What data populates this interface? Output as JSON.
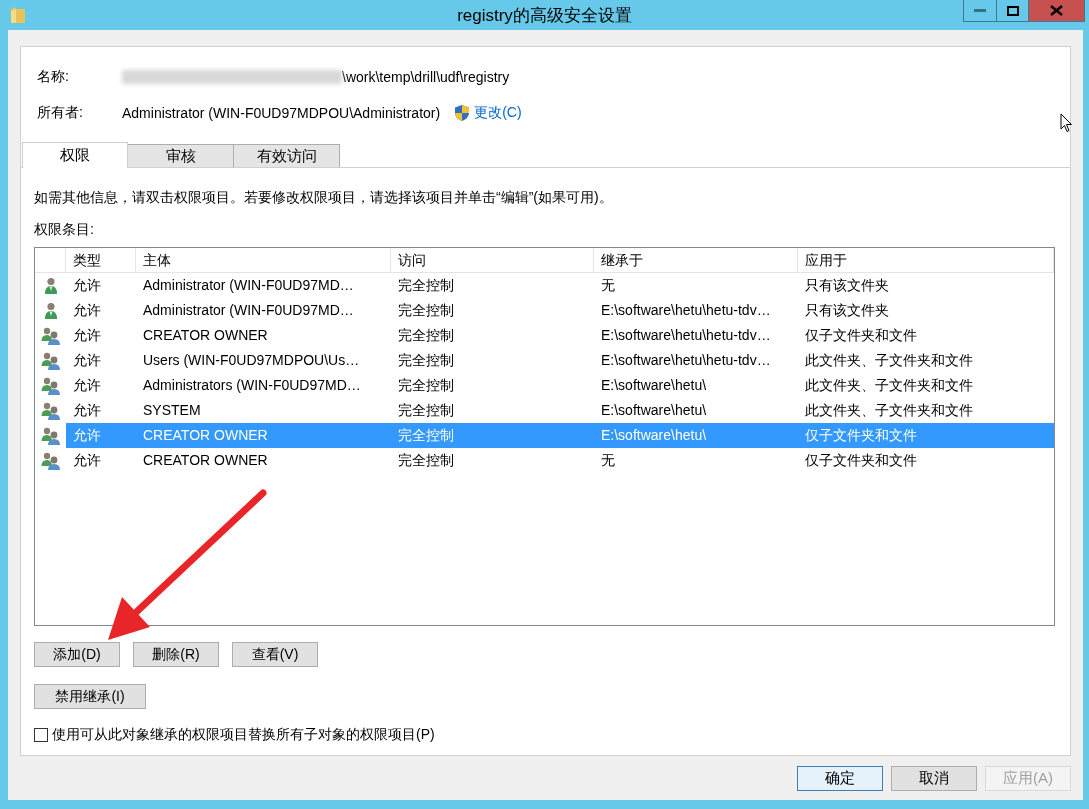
{
  "window": {
    "title": "registry的高级安全设置"
  },
  "name": {
    "label": "名称:",
    "value": "\\work\\temp\\drill\\udf\\registry"
  },
  "owner": {
    "label": "所有者:",
    "value": "Administrator (WIN-F0UD97MDPOU\\Administrator)",
    "change_link": "更改(C)"
  },
  "tabs": [
    {
      "label": "权限",
      "selected": true
    },
    {
      "label": "审核",
      "selected": false
    },
    {
      "label": "有效访问",
      "selected": false
    }
  ],
  "info_text": "如需其他信息，请双击权限项目。若要修改权限项目，请选择该项目并单击“编辑”(如果可用)。",
  "entries_label": "权限条目:",
  "table": {
    "columns": [
      "类型",
      "主体",
      "访问",
      "继承于",
      "应用于"
    ],
    "rows": [
      {
        "kind": "user",
        "type": "允许",
        "principal": "Administrator (WIN-F0UD97MD…",
        "access": "完全控制",
        "inherited_from": "无",
        "applies_to": "只有该文件夹",
        "selected": false
      },
      {
        "kind": "user",
        "type": "允许",
        "principal": "Administrator (WIN-F0UD97MD…",
        "access": "完全控制",
        "inherited_from": "E:\\software\\hetu\\hetu-tdv…",
        "applies_to": "只有该文件夹",
        "selected": false
      },
      {
        "kind": "group",
        "type": "允许",
        "principal": "CREATOR OWNER",
        "access": "完全控制",
        "inherited_from": "E:\\software\\hetu\\hetu-tdv…",
        "applies_to": "仅子文件夹和文件",
        "selected": false
      },
      {
        "kind": "group",
        "type": "允许",
        "principal": "Users (WIN-F0UD97MDPOU\\Us…",
        "access": "完全控制",
        "inherited_from": "E:\\software\\hetu\\hetu-tdv…",
        "applies_to": "此文件夹、子文件夹和文件",
        "selected": false
      },
      {
        "kind": "group",
        "type": "允许",
        "principal": "Administrators (WIN-F0UD97MD…",
        "access": "完全控制",
        "inherited_from": "E:\\software\\hetu\\",
        "applies_to": "此文件夹、子文件夹和文件",
        "selected": false
      },
      {
        "kind": "group",
        "type": "允许",
        "principal": "SYSTEM",
        "access": "完全控制",
        "inherited_from": "E:\\software\\hetu\\",
        "applies_to": "此文件夹、子文件夹和文件",
        "selected": false
      },
      {
        "kind": "group",
        "type": "允许",
        "principal": "CREATOR OWNER",
        "access": "完全控制",
        "inherited_from": "E:\\software\\hetu\\",
        "applies_to": "仅子文件夹和文件",
        "selected": true
      },
      {
        "kind": "group",
        "type": "允许",
        "principal": "CREATOR OWNER",
        "access": "完全控制",
        "inherited_from": "无",
        "applies_to": "仅子文件夹和文件",
        "selected": false
      }
    ]
  },
  "entry_buttons": [
    {
      "label": "添加(D)"
    },
    {
      "label": "删除(R)"
    },
    {
      "label": "查看(V)"
    }
  ],
  "inheritance_button": {
    "label": "禁用继承(I)"
  },
  "replace_checkbox": {
    "label": "使用可从此对象继承的权限项目替换所有子对象的权限项目(P)",
    "checked": false
  },
  "footer_buttons": [
    {
      "label": "确定",
      "default": true,
      "disabled": false
    },
    {
      "label": "取消",
      "default": false,
      "disabled": false
    },
    {
      "label": "应用(A)",
      "default": false,
      "disabled": true
    }
  ]
}
